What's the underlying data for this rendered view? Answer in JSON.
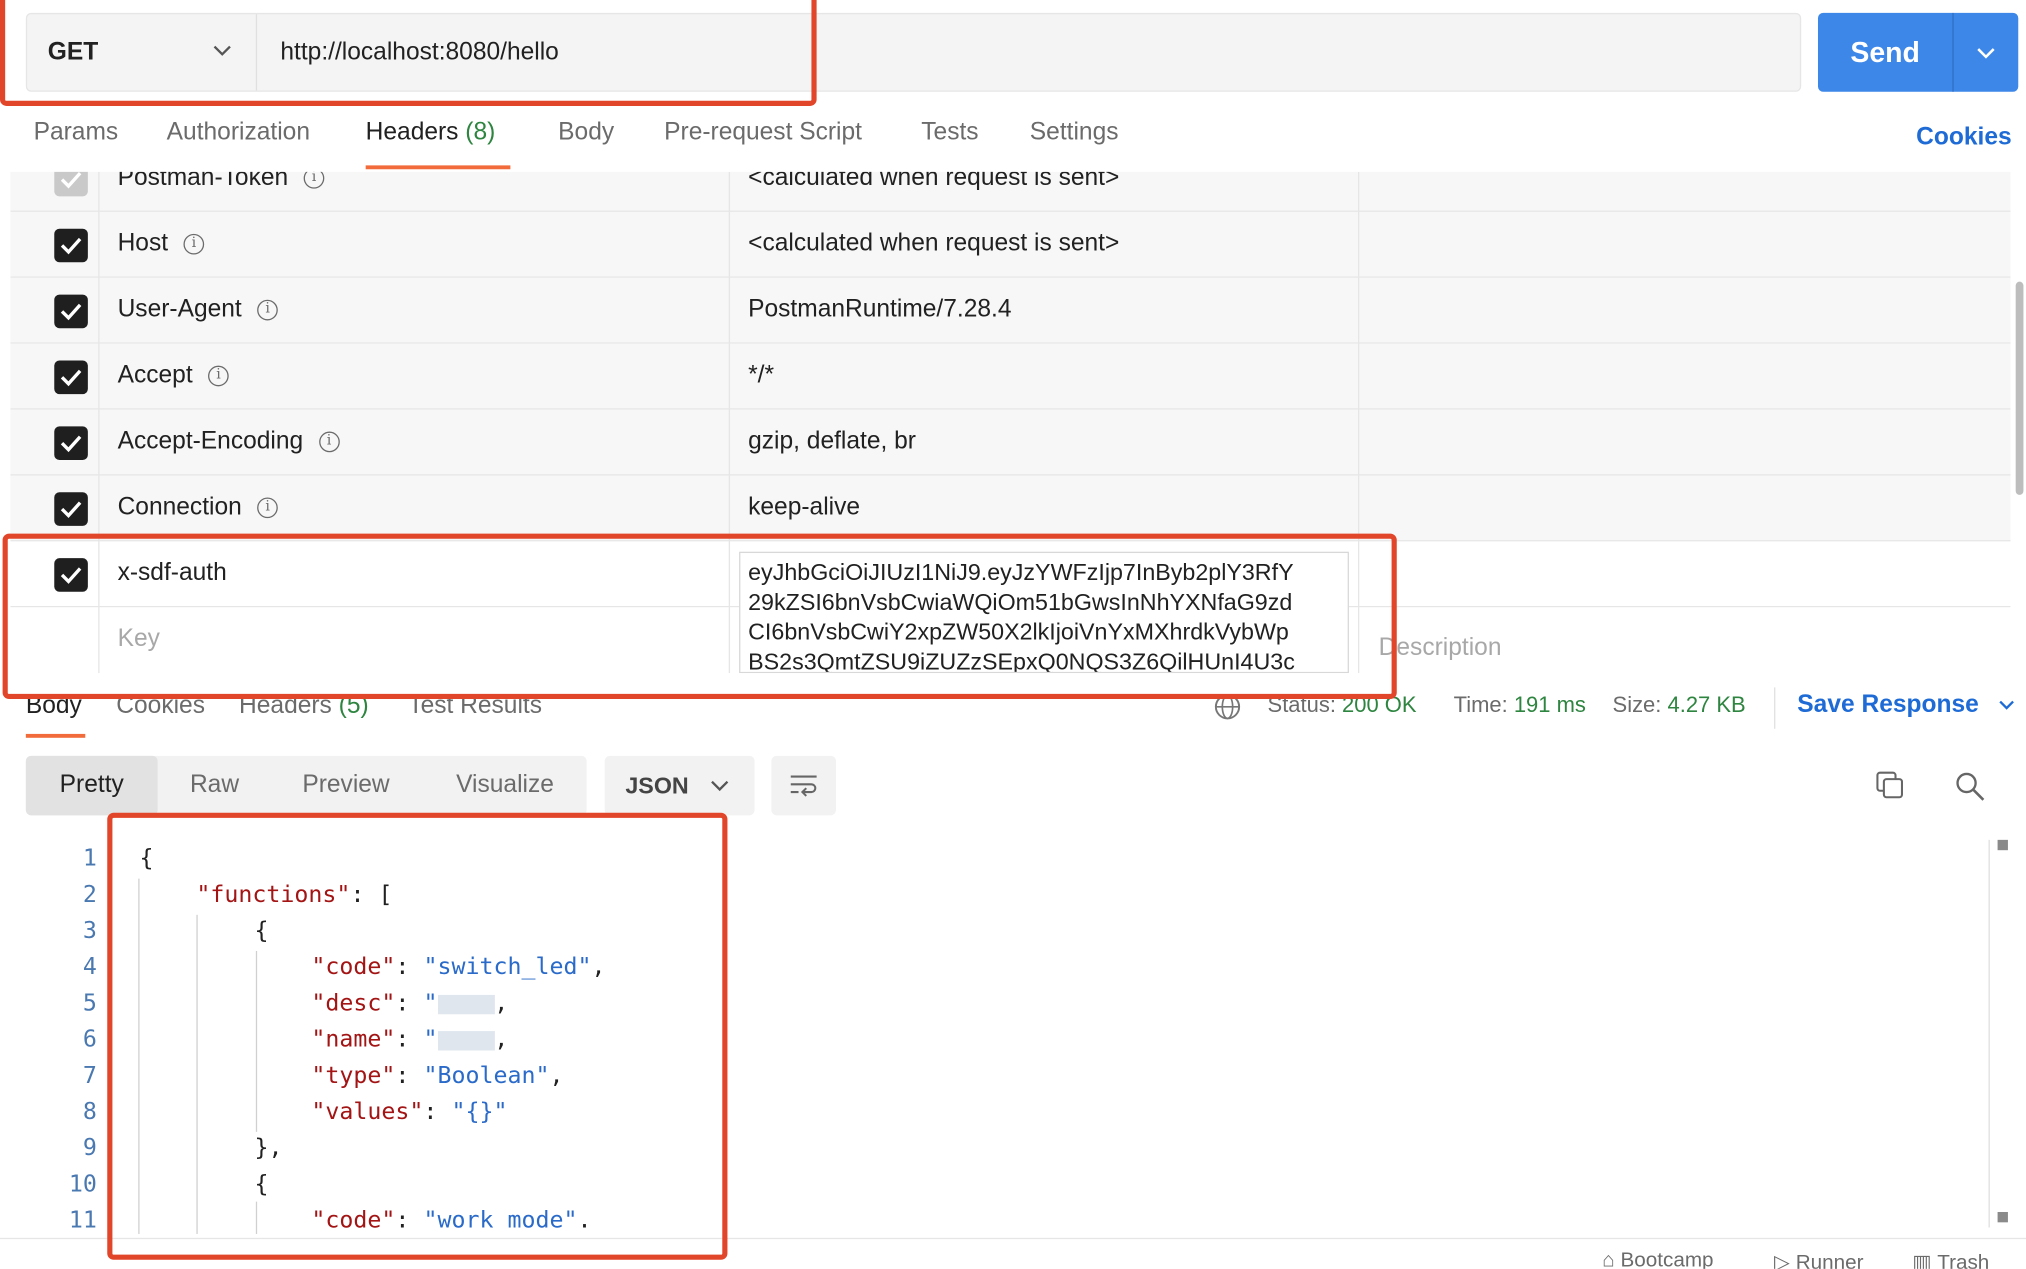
{
  "request": {
    "method": "GET",
    "url": "http://localhost:8080/hello",
    "send_label": "Send"
  },
  "request_tabs": {
    "params": "Params",
    "authorization": "Authorization",
    "headers": "Headers",
    "headers_count": "(8)",
    "body": "Body",
    "pre_request": "Pre-request Script",
    "tests": "Tests",
    "settings": "Settings",
    "cookies": "Cookies"
  },
  "headers": {
    "rows": [
      {
        "key": "Postman-Token",
        "value": "<calculated when request is sent>"
      },
      {
        "key": "Host",
        "value": "<calculated when request is sent>"
      },
      {
        "key": "User-Agent",
        "value": "PostmanRuntime/7.28.4"
      },
      {
        "key": "Accept",
        "value": "*/*"
      },
      {
        "key": "Accept-Encoding",
        "value": "gzip, deflate, br"
      },
      {
        "key": "Connection",
        "value": "keep-alive"
      },
      {
        "key": "x-sdf-auth"
      }
    ],
    "jwt_lines": [
      "eyJhbGciOiJIUzI1NiJ9.eyJzYWFzIjp7InByb2plY3RfY",
      "29kZSI6bnVsbCwiaWQiOm51bGwsInNhYXNfaG9zd",
      "CI6bnVsbCwiY2xpZW50X2lkIjoiVnYxMXhrdkVybWp",
      "BS2s3QmtZSU9iZUZzSEpxQ0NQS3Z6QilHUnI4U3c"
    ],
    "key_placeholder": "Key",
    "description_placeholder": "Description"
  },
  "response": {
    "tabs": {
      "body": "Body",
      "cookies": "Cookies",
      "headers": "Headers",
      "headers_count": "(5)",
      "test_results": "Test Results"
    },
    "status_label": "Status:",
    "status_value": "200 OK",
    "time_label": "Time:",
    "time_value": "191 ms",
    "size_label": "Size:",
    "size_value": "4.27 KB",
    "save_label": "Save Response",
    "views": {
      "pretty": "Pretty",
      "raw": "Raw",
      "preview": "Preview",
      "visualize": "Visualize"
    },
    "format": "JSON",
    "code": {
      "line_numbers": [
        "1",
        "2",
        "3",
        "4",
        "5",
        "6",
        "7",
        "8",
        "9",
        "10",
        "11"
      ],
      "open_brace": "{",
      "functions_key": "\"functions\"",
      "open_bracket": "[",
      "obj_open": "{",
      "code_key": "\"code\"",
      "code_value": "\"switch_led\"",
      "desc_key": "\"desc\"",
      "name_key": "\"name\"",
      "type_key": "\"type\"",
      "type_value": "\"Boolean\"",
      "values_key": "\"values\"",
      "values_value": "\"{}\"",
      "obj_close": "},",
      "code_value_2": "\"work mode\""
    }
  },
  "footer": {
    "bootcamp": "Bootcamp",
    "runner": "Runner",
    "trash": "Trash"
  },
  "colors": {
    "accent": "#3c87e8",
    "annotation": "#e2462a",
    "tab_underline": "#f26b3a",
    "success": "#2e8540"
  }
}
